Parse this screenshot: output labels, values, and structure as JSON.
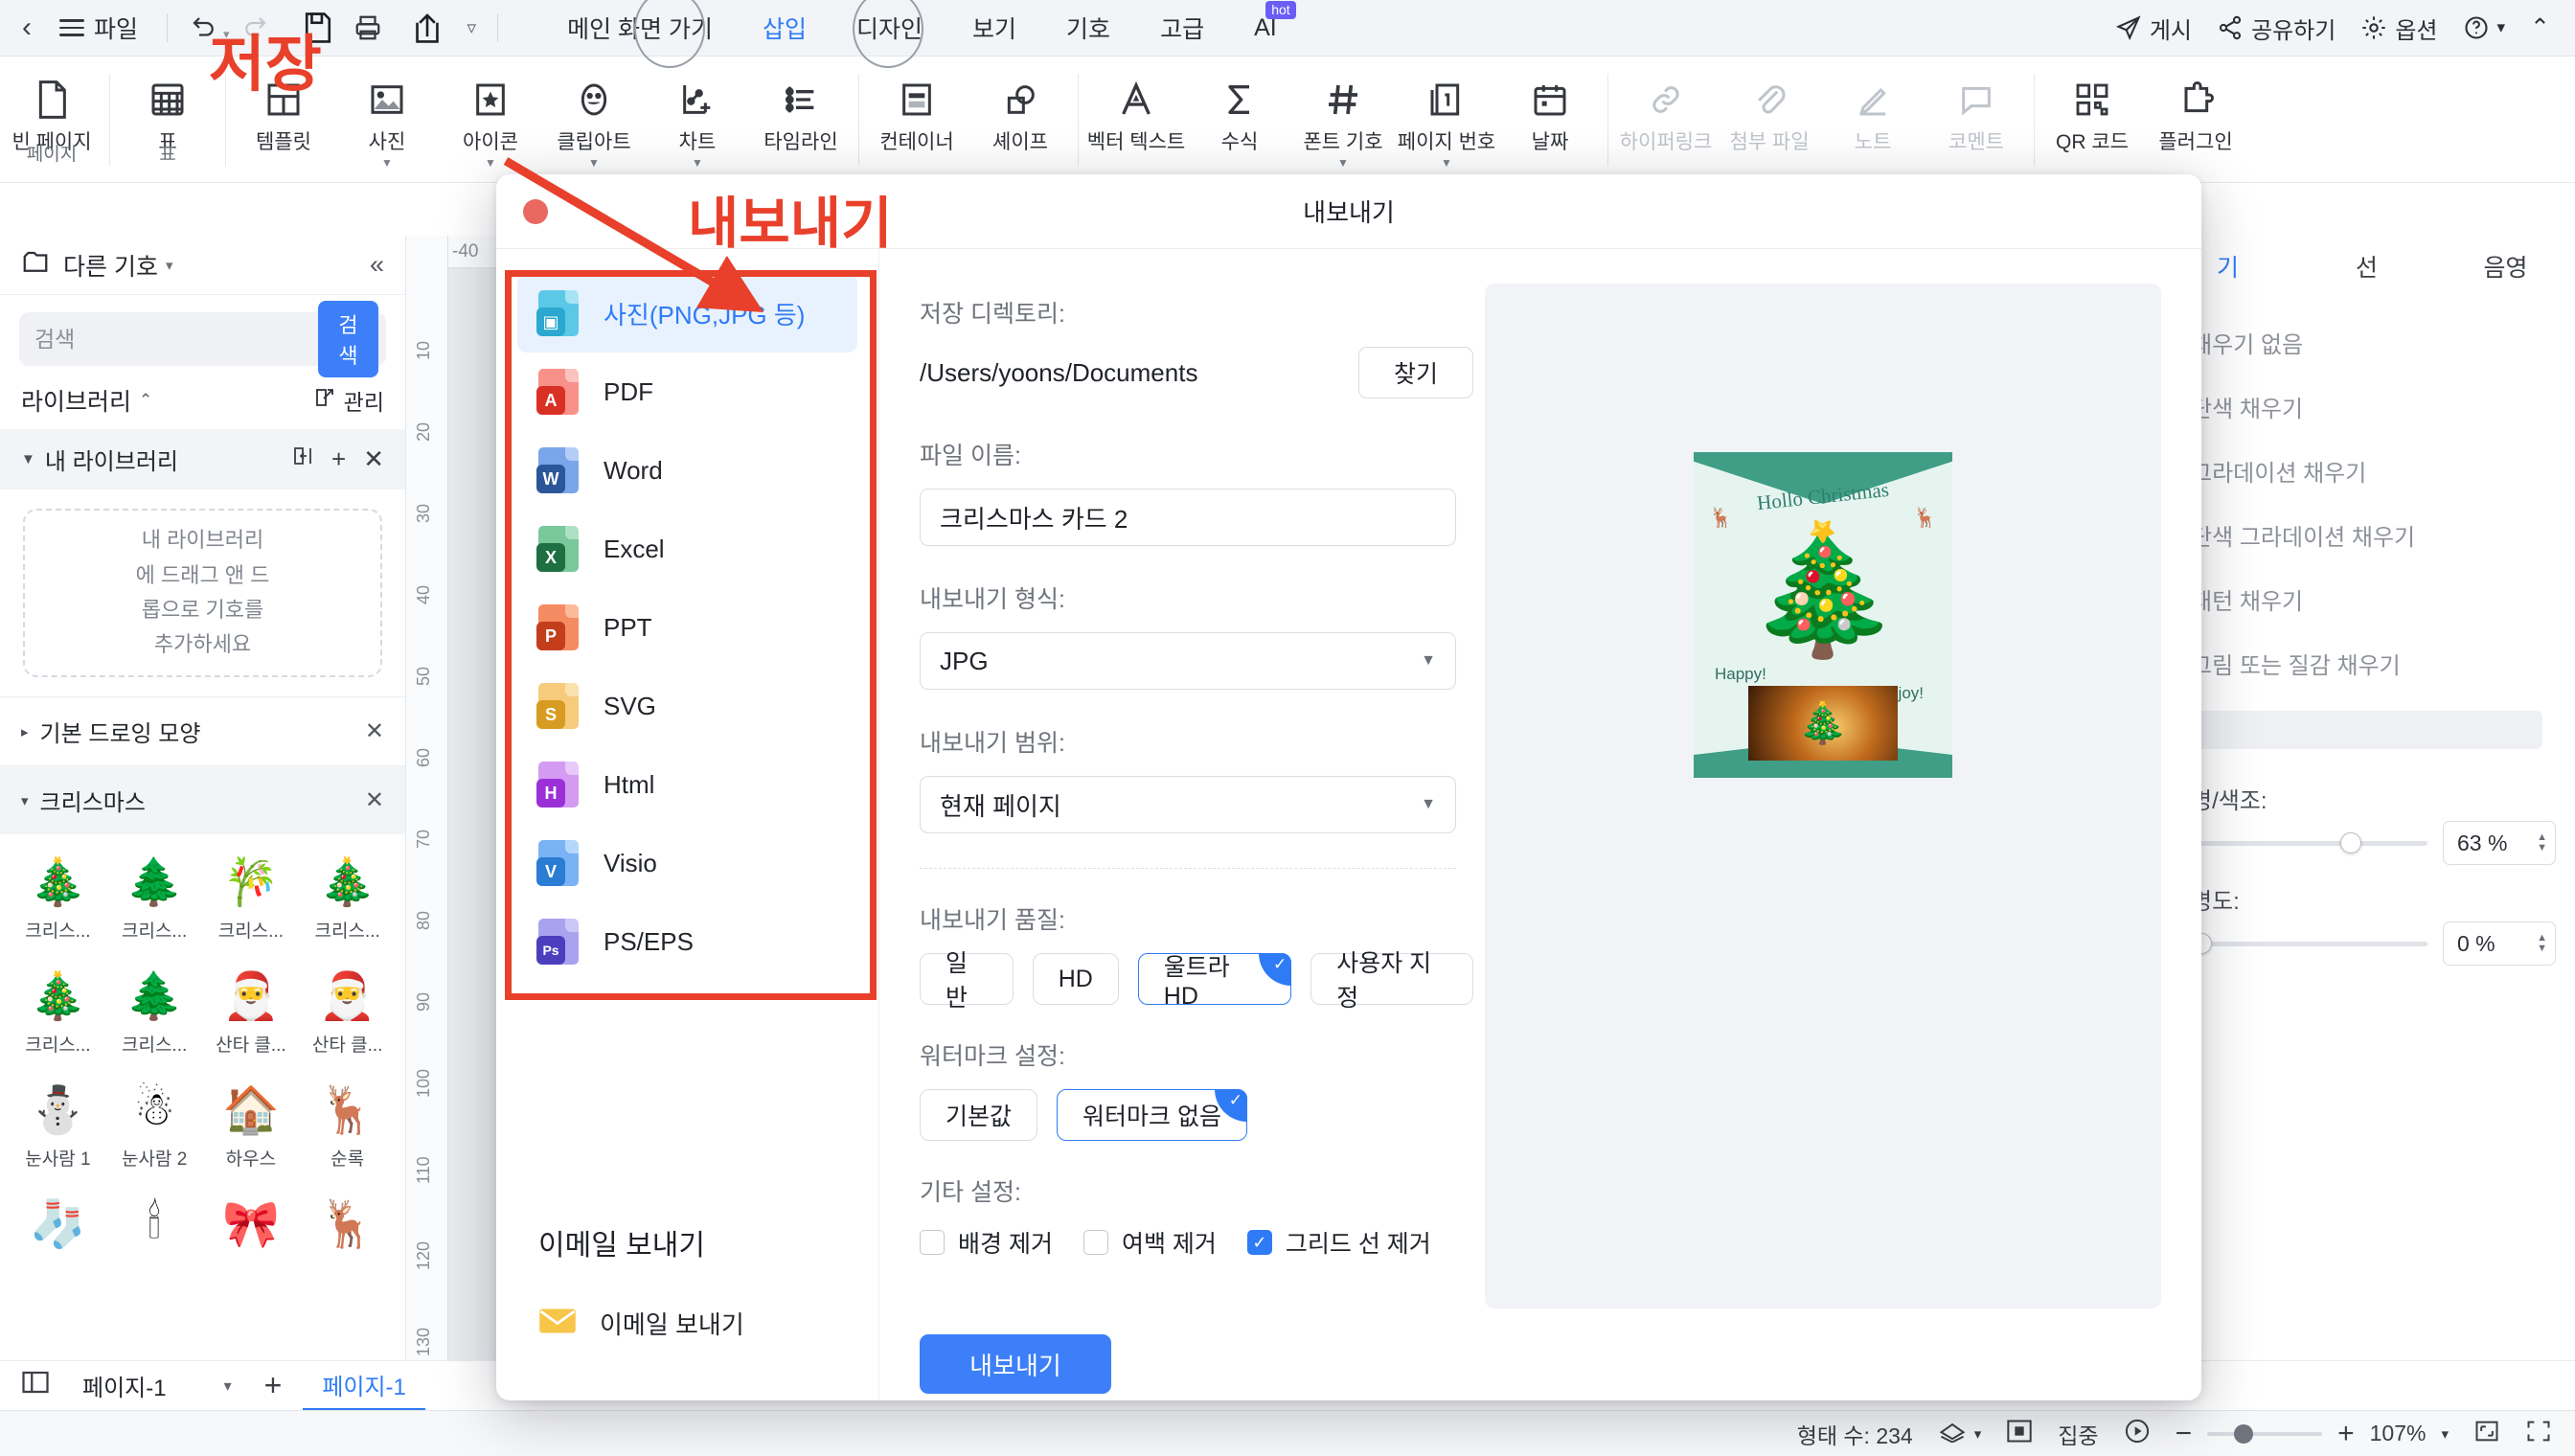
{
  "topbar": {
    "back_icon": "chevron-left-icon",
    "file_label": "파일",
    "undo_icon": "undo-icon",
    "redo_icon": "redo-icon",
    "save_icon": "save-icon",
    "print_icon": "print-icon",
    "export_icon": "export-icon",
    "more_caret": "▿",
    "tabs": [
      {
        "label": "메인 화면 가기",
        "active": false
      },
      {
        "label": "삽입",
        "active": true
      },
      {
        "label": "디자인",
        "active": false
      },
      {
        "label": "보기",
        "active": false
      },
      {
        "label": "기호",
        "active": false
      },
      {
        "label": "고급",
        "active": false
      },
      {
        "label": "AI",
        "active": false,
        "badge": "hot"
      }
    ],
    "right": [
      {
        "label": "게시",
        "icon": "publish-icon"
      },
      {
        "label": "공유하기",
        "icon": "share-icon"
      },
      {
        "label": "옵션",
        "icon": "gear-icon"
      }
    ],
    "help_icon": "help-circle-icon",
    "help_caret": "▾",
    "collapse_caret": "⌃"
  },
  "ribbon": {
    "groups": [
      {
        "label": "페이지",
        "items": [
          {
            "label": "빈 페이지",
            "icon": "blank-page-icon",
            "caret": false,
            "disabled": false
          }
        ]
      },
      {
        "label": "표",
        "items": [
          {
            "label": "표",
            "icon": "table-icon",
            "caret": false,
            "disabled": false
          }
        ]
      },
      {
        "label": "",
        "items": [
          {
            "label": "템플릿",
            "icon": "template-icon",
            "caret": false,
            "disabled": false
          },
          {
            "label": "사진",
            "icon": "photo-icon",
            "caret": true,
            "disabled": false
          },
          {
            "label": "아이콘",
            "icon": "icon-star-icon",
            "caret": true,
            "disabled": false
          },
          {
            "label": "클립아트",
            "icon": "clipart-face-icon",
            "caret": true,
            "disabled": false
          },
          {
            "label": "차트",
            "icon": "chart-icon",
            "caret": true,
            "disabled": false
          },
          {
            "label": "타임라인",
            "icon": "timeline-icon",
            "caret": false,
            "disabled": false
          }
        ]
      },
      {
        "label": "",
        "items": [
          {
            "label": "컨테이너",
            "icon": "container-icon",
            "caret": false,
            "disabled": false
          },
          {
            "label": "셰이프",
            "icon": "shape-icon",
            "caret": false,
            "disabled": false
          }
        ]
      },
      {
        "label": "",
        "items": [
          {
            "label": "벡터 텍스트",
            "icon": "vector-text-icon",
            "caret": false,
            "disabled": false
          },
          {
            "label": "수식",
            "icon": "formula-sigma-icon",
            "caret": false,
            "disabled": false
          },
          {
            "label": "폰트 기호",
            "icon": "font-symbol-hash-icon",
            "caret": true,
            "disabled": false
          },
          {
            "label": "페이지 번호",
            "icon": "page-number-icon",
            "caret": true,
            "disabled": false
          },
          {
            "label": "날짜",
            "icon": "calendar-icon",
            "caret": false,
            "disabled": false
          }
        ]
      },
      {
        "label": "",
        "items": [
          {
            "label": "하이퍼링크",
            "icon": "hyperlink-icon",
            "caret": false,
            "disabled": true
          },
          {
            "label": "첨부 파일",
            "icon": "attachment-icon",
            "caret": false,
            "disabled": true
          },
          {
            "label": "노트",
            "icon": "note-pencil-icon",
            "caret": false,
            "disabled": true
          },
          {
            "label": "코멘트",
            "icon": "comment-icon",
            "caret": false,
            "disabled": true
          }
        ]
      },
      {
        "label": "",
        "items": [
          {
            "label": "QR 코드",
            "icon": "qr-code-icon",
            "caret": false,
            "disabled": false
          },
          {
            "label": "플러그인",
            "icon": "plugin-icon",
            "caret": false,
            "disabled": false
          }
        ]
      }
    ]
  },
  "left_sidebar": {
    "header_icon": "symbol-library-icon",
    "header_title": "다른 기호",
    "header_caret": "▾",
    "collapse_icon": "collapse-left-icon",
    "search_placeholder": "검색",
    "search_value": "",
    "search_button": "검색",
    "library_title": "라이브러리",
    "library_caret": "⌃",
    "manage_label": "관리",
    "manage_icon": "edit-square-icon",
    "my_library_label": "내 라이브러리",
    "my_library_icons": [
      "import-icon",
      "plus-icon",
      "close-icon"
    ],
    "dropzone_text": "내 라이브러리\n에 드래그 앤 드\n롭으로 기호를\n추가하세요",
    "sections": [
      {
        "label": "기본 드로잉 모양",
        "caret": "▸",
        "close": "✕"
      },
      {
        "label": "크리스마스",
        "caret": "▾",
        "close": "✕"
      }
    ],
    "symbols": [
      {
        "label": "크리스...",
        "glyph": "🎄"
      },
      {
        "label": "크리스...",
        "glyph": "🌲"
      },
      {
        "label": "크리스...",
        "glyph": "🎋"
      },
      {
        "label": "크리스...",
        "glyph": "🎄"
      },
      {
        "label": "크리스...",
        "glyph": "🎄"
      },
      {
        "label": "크리스...",
        "glyph": "🌲"
      },
      {
        "label": "산타 클...",
        "glyph": "🎅"
      },
      {
        "label": "산타 클...",
        "glyph": "🎅"
      },
      {
        "label": "눈사람 1",
        "glyph": "⛄"
      },
      {
        "label": "눈사람 2",
        "glyph": "☃"
      },
      {
        "label": "하우스",
        "glyph": "🏠"
      },
      {
        "label": "순록",
        "glyph": "🦌"
      },
      {
        "label": "",
        "glyph": "🧦"
      },
      {
        "label": "",
        "glyph": "🕯"
      },
      {
        "label": "",
        "glyph": "🎀"
      },
      {
        "label": "",
        "glyph": "🦌"
      }
    ]
  },
  "rulers": {
    "h_labels": [
      "-40"
    ],
    "v_labels": [
      "10",
      "20",
      "30",
      "40",
      "50",
      "60",
      "70",
      "80",
      "90",
      "100",
      "110",
      "120",
      "130"
    ]
  },
  "right_sidebar": {
    "tabs": [
      {
        "label": "기",
        "active": true
      },
      {
        "label": "선",
        "active": false
      },
      {
        "label": "음영",
        "active": false
      }
    ],
    "fill_options": [
      "채우기 없음",
      "단색 채우기",
      "그라데이션 채우기",
      "단색 그라데이션 채우기",
      "패턴 채우기",
      "그림 또는 질감 채우기"
    ],
    "tone_label": "명/색조:",
    "tone_value": "63 %",
    "opacity_label": "명도:",
    "opacity_value": "0 %"
  },
  "dialog": {
    "title": "내보내기",
    "close_icon": "close-red-dot-icon",
    "formats": [
      {
        "label": "사진(PNG,JPG 등)",
        "badge": "",
        "icon": "image-file-icon",
        "color": "#5bc8e8",
        "dark": "#2ba8cf",
        "selected": true
      },
      {
        "label": "PDF",
        "badge": "",
        "icon": "pdf-file-icon",
        "color": "#f79189",
        "dark": "#d93025",
        "selected": false
      },
      {
        "label": "Word",
        "badge": "W",
        "icon": "word-file-icon",
        "color": "#7aa5ea",
        "dark": "#2b579a",
        "selected": false
      },
      {
        "label": "Excel",
        "badge": "X",
        "icon": "excel-file-icon",
        "color": "#79c79a",
        "dark": "#1e6f42",
        "selected": false
      },
      {
        "label": "PPT",
        "badge": "P",
        "icon": "ppt-file-icon",
        "color": "#f58b62",
        "dark": "#c43e1c",
        "selected": false
      },
      {
        "label": "SVG",
        "badge": "S",
        "icon": "svg-file-icon",
        "color": "#f6cc7c",
        "dark": "#d89b21",
        "selected": false
      },
      {
        "label": "Html",
        "badge": "H",
        "icon": "html-file-icon",
        "color": "#d39cf2",
        "dark": "#9b30d9",
        "selected": false
      },
      {
        "label": "Visio",
        "badge": "V",
        "icon": "visio-file-icon",
        "color": "#7ab3f5",
        "dark": "#2b7cd3",
        "selected": false
      },
      {
        "label": "PS/EPS",
        "badge": "Ps",
        "icon": "ps-eps-file-icon",
        "color": "#a9a3ef",
        "dark": "#4b3fbe",
        "selected": false
      }
    ],
    "email_section_title": "이메일 보내기",
    "email_item_label": "이메일 보내기",
    "email_item_icon": "envelope-icon",
    "form": {
      "dir_label": "저장 디렉토리:",
      "dir_value": "/Users/yoons/Documents",
      "find_button": "찾기",
      "filename_label": "파일 이름:",
      "filename_value": "크리스마스 카드 2",
      "format_label": "내보내기 형식:",
      "format_value": "JPG",
      "range_label": "내보내기 범위:",
      "range_value": "현재 페이지",
      "quality_label": "내보내기 품질:",
      "quality_options": [
        {
          "label": "일반",
          "selected": false
        },
        {
          "label": "HD",
          "selected": false
        },
        {
          "label": "울트라 HD",
          "selected": true
        },
        {
          "label": "사용자 지정",
          "selected": false
        }
      ],
      "watermark_label": "워터마크 설정:",
      "watermark_options": [
        {
          "label": "기본값",
          "selected": false
        },
        {
          "label": "워터마크 없음",
          "selected": true
        }
      ],
      "other_label": "기타 설정:",
      "checkboxes": [
        {
          "label": "배경 제거",
          "checked": false
        },
        {
          "label": "여백 제거",
          "checked": false
        },
        {
          "label": "그리드 선 제거",
          "checked": true
        }
      ],
      "export_button": "내보내기"
    },
    "preview": {
      "card_title": "Hollo Christmas",
      "happy_text": "Happy!",
      "enjoy_text": "Enjoy!",
      "tree_glyph": "🎄",
      "deer_glyph": "🦌",
      "photo_glyph": "🎄"
    }
  },
  "annotations": {
    "save_text": "저장",
    "export_text": "내보내기",
    "accent_color": "#e8402a"
  },
  "page_tabs": {
    "layout_icon": "layout-icon",
    "page_select_value": "페이지-1",
    "select_caret": "▾",
    "add_icon": "plus-icon",
    "active_tab": "페이지-1"
  },
  "status_bar": {
    "shape_count_label": "형태 수: 234",
    "theme_icon": "theme-icon",
    "theme_caret": "▾",
    "focus_icon": "focus-frame-icon",
    "focus_label": "집중",
    "play_icon": "play-icon",
    "zoom_out_icon": "minus-icon",
    "zoom_in_icon": "plus-icon",
    "zoom_value": "107%",
    "zoom_caret": "▾",
    "fit_icon": "fit-page-icon",
    "fullscreen_icon": "fullscreen-icon"
  }
}
